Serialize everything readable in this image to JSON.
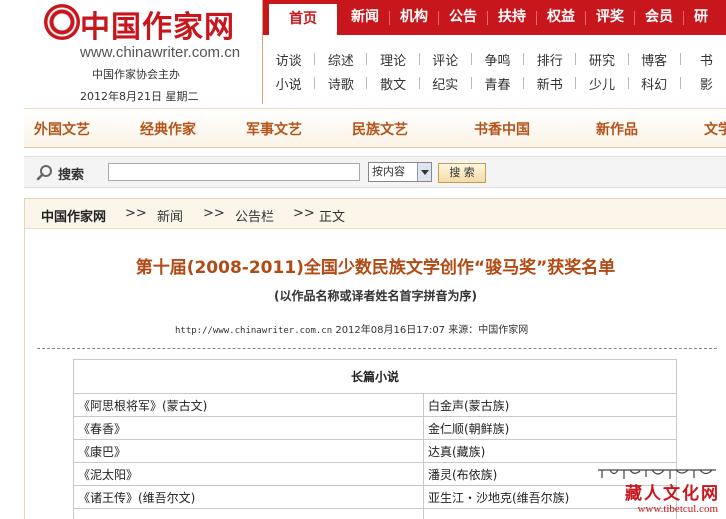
{
  "header": {
    "logo_text": "中国作家网",
    "url": "www.chinawriter.com.cn",
    "host": "中国作家协会主办",
    "date": "2012年8月21日 星期二"
  },
  "nav": {
    "main": [
      "首页",
      "新闻",
      "机构",
      "公告",
      "扶持",
      "权益",
      "评奖",
      "会员",
      "研"
    ],
    "sub_row1": [
      "访谈",
      "综述",
      "理论",
      "评论",
      "争鸣",
      "排行",
      "研究",
      "博客",
      "书"
    ],
    "sub_row2": [
      "小说",
      "诗歌",
      "散文",
      "纪实",
      "青春",
      "新书",
      "少儿",
      "科幻",
      "影"
    ]
  },
  "categories": [
    "外国文艺",
    "经典作家",
    "军事文艺",
    "民族文艺",
    "书香中国",
    "新作品",
    "文学"
  ],
  "search": {
    "label": "搜索",
    "input_value": "",
    "select_value": "按内容",
    "button_label": "搜 索"
  },
  "breadcrumb": {
    "home": "中国作家网",
    "sep": ">>",
    "items": [
      "新闻",
      "公告栏",
      "正文"
    ]
  },
  "article": {
    "title": "第十届(2008-2011)全国少数民族文学创作“骏马奖”获奖名单",
    "subtitle": "(以作品名称或译者姓名首字拼音为序)",
    "meta_url": "http://www.chinawriter.com.cn",
    "meta_time": "2012年08月16日17:07",
    "meta_source": "来源：中国作家网"
  },
  "award_table": {
    "category": "长篇小说",
    "rows": [
      [
        "《阿思根将军》(蒙古文)",
        "白金声(蒙古族)"
      ],
      [
        "《春香》",
        "金仁顺(朝鲜族)"
      ],
      [
        "《康巴》",
        "达真(藏族)"
      ],
      [
        "《泥太阳》",
        "潘灵(布依族)"
      ],
      [
        "《诸王传》(维吾尔文)",
        "亚生江・沙地克(维吾尔族)"
      ]
    ]
  },
  "watermark": {
    "cn": "藏人文化网",
    "url": "www.tibetcul.com"
  },
  "colors": {
    "brand_red": "#c8161d",
    "category_orange": "#b4541b",
    "title_brown": "#b14a14"
  }
}
